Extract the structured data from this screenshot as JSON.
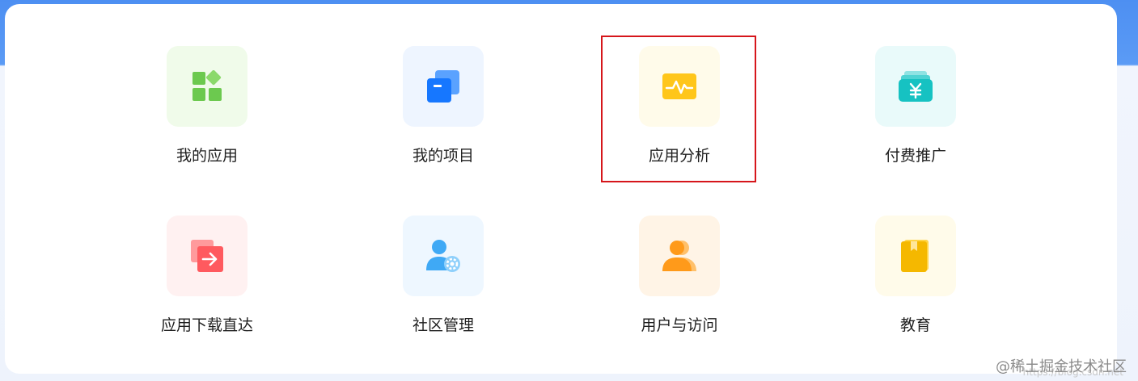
{
  "colors": {
    "accent_blue": "#4d8ff2",
    "highlight_red": "#d6161b",
    "icon_green": "#6cc94f",
    "icon_blue": "#1677ff",
    "icon_yellow": "#ffc61a",
    "icon_teal": "#16c2c2",
    "icon_red": "#ff5a5f",
    "icon_sky": "#3fa9f5",
    "icon_orange": "#ff9a1a",
    "icon_gold": "#f5b800"
  },
  "grid": {
    "items": [
      {
        "label": "我的应用",
        "icon": "app-grid-icon",
        "bg": "#f0fbea"
      },
      {
        "label": "我的项目",
        "icon": "project-stack-icon",
        "bg": "#eef5ff"
      },
      {
        "label": "应用分析",
        "icon": "analytics-pulse-icon",
        "bg": "#fffbea",
        "highlighted": true
      },
      {
        "label": "付费推广",
        "icon": "paid-yen-icon",
        "bg": "#e9fafa"
      },
      {
        "label": "应用下载直达",
        "icon": "download-arrow-icon",
        "bg": "#fff1f1"
      },
      {
        "label": "社区管理",
        "icon": "user-gear-icon",
        "bg": "#eef7ff"
      },
      {
        "label": "用户与访问",
        "icon": "user-access-icon",
        "bg": "#fff4e6"
      },
      {
        "label": "教育",
        "icon": "book-icon",
        "bg": "#fffbea"
      }
    ]
  },
  "watermark": {
    "text": "@稀土掘金技术社区",
    "url": "https://blog.csdn.net"
  }
}
